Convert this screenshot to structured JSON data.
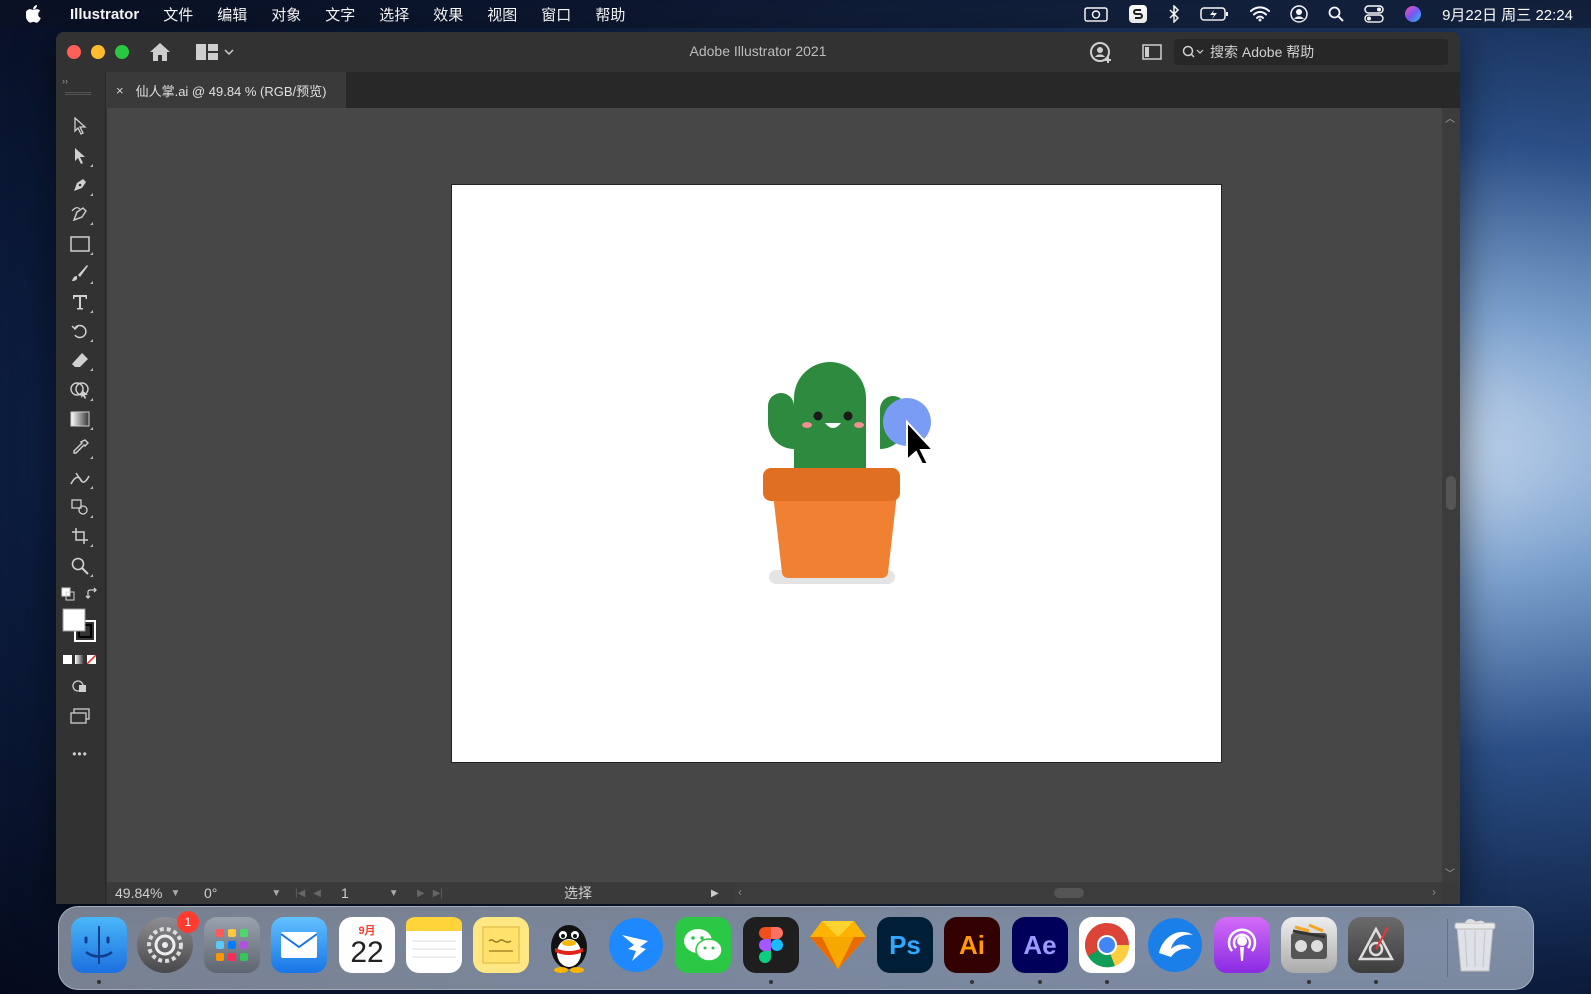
{
  "menubar": {
    "app_name": "Illustrator",
    "items": [
      "文件",
      "编辑",
      "对象",
      "文字",
      "选择",
      "效果",
      "视图",
      "窗口",
      "帮助"
    ],
    "clock": "9月22日 周三  22:24"
  },
  "window": {
    "title": "Adobe Illustrator 2021",
    "help_search_placeholder": "搜索 Adobe 帮助"
  },
  "document": {
    "tab_label": "仙人掌.ai @ 49.84 % (RGB/预览)",
    "tab_close": "×"
  },
  "statusbar": {
    "zoom": "49.84%",
    "rotation": "0°",
    "artboard_number": "1",
    "current_tool": "选择"
  },
  "toolbar": {
    "more": "•••"
  },
  "dock": {
    "settings_badge": "1",
    "calendar_month": "9月",
    "calendar_day": "22",
    "photoshop_label": "Ps",
    "illustrator_label": "Ai",
    "aftereffects_label": "Ae"
  },
  "colors": {
    "cactus_green": "#2d8a3e",
    "pot_orange": "#f08132",
    "pot_rim": "#e06f22",
    "cursor_highlight": "#7b9cf5"
  }
}
